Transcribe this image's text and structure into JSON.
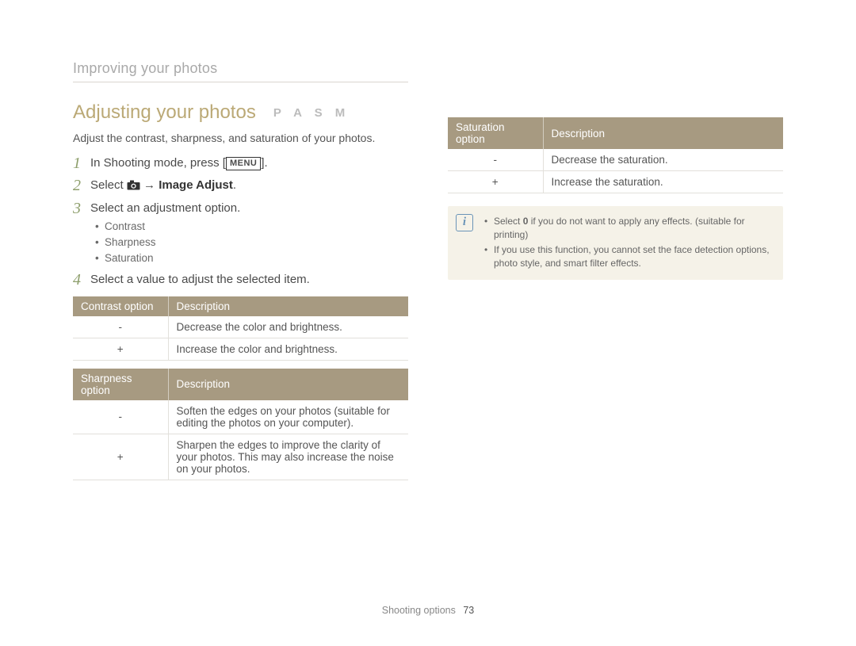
{
  "breadcrumb": "Improving your photos",
  "heading": "Adjusting your photos",
  "modes": "P A S M",
  "intro": "Adjust the contrast, sharpness, and saturation of your photos.",
  "steps": {
    "s1_a": "In Shooting mode, press [",
    "s1_menu": "MENU",
    "s1_b": "].",
    "s2_a": "Select ",
    "s2_arrow": " → ",
    "s2_bold": "Image Adjust",
    "s2_b": ".",
    "s3": "Select an adjustment option.",
    "s3_items": {
      "a": "Contrast",
      "b": "Sharpness",
      "c": "Saturation"
    },
    "s4": "Select a value to adjust the selected item."
  },
  "tables": {
    "contrast": {
      "h1": "Contrast option",
      "h2": "Description",
      "r1": {
        "opt": "-",
        "desc": "Decrease the color and brightness."
      },
      "r2": {
        "opt": "+",
        "desc": "Increase the color and brightness."
      }
    },
    "sharpness": {
      "h1": "Sharpness option",
      "h2": "Description",
      "r1": {
        "opt": "-",
        "desc": "Soften the edges on your photos (suitable for editing the photos on your computer)."
      },
      "r2": {
        "opt": "+",
        "desc": "Sharpen the edges to improve the clarity of your photos. This may also increase the noise on your photos."
      }
    },
    "saturation": {
      "h1": "Saturation option",
      "h2": "Description",
      "r1": {
        "opt": "-",
        "desc": "Decrease the saturation."
      },
      "r2": {
        "opt": "+",
        "desc": "Increase the saturation."
      }
    }
  },
  "note": {
    "l1_a": "Select ",
    "l1_bold": "0",
    "l1_b": " if you do not want to apply any effects. (suitable for printing)",
    "l2": "If you use this function, you cannot set the face detection options, photo style, and smart filter effects."
  },
  "footer": {
    "section": "Shooting options",
    "page": "73"
  }
}
